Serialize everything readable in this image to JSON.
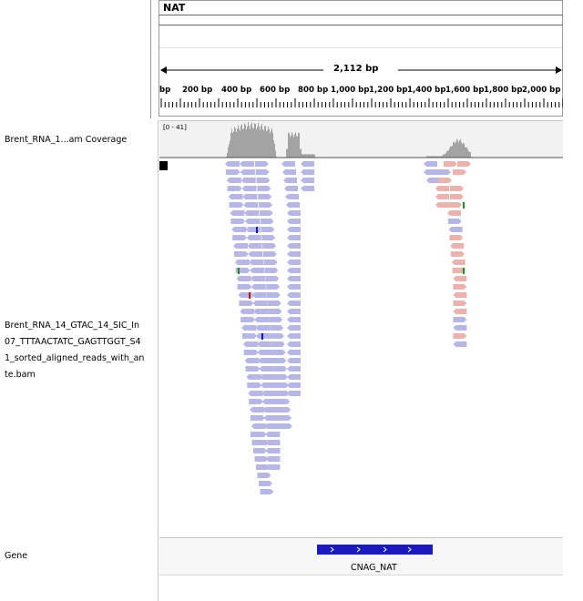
{
  "header": {
    "chromosome": "NAT",
    "span_label": "2,112 bp",
    "ticks": [
      "bp",
      "200 bp",
      "400 bp",
      "600 bp",
      "800 bp",
      "1,000 bp",
      "1,200 bp",
      "1,400 bp",
      "1,600 bp",
      "1,800 bp",
      "2,000 bp"
    ]
  },
  "tracks": {
    "coverage_label": "Brent_RNA_1...am Coverage",
    "coverage_range": "[0 - 41]",
    "alignment_label_lines": [
      "Brent_RNA_14_GTAC_14_SIC_In",
      "07_TTTAACTATC_GAGTTGGT_S4",
      "1_sorted_aligned_reads_with_an",
      "te.bam"
    ],
    "gene_label": "Gene",
    "gene_name": "CNAG_NAT"
  },
  "colors": {
    "forward_read": "#b7b7e6",
    "reverse_read": "#eab3ae",
    "coverage": "#a3a3a3",
    "gene": "#1a1abf",
    "mismatch_red": "#d01010",
    "mismatch_blue": "#1010d0",
    "mismatch_green": "#209020"
  }
}
